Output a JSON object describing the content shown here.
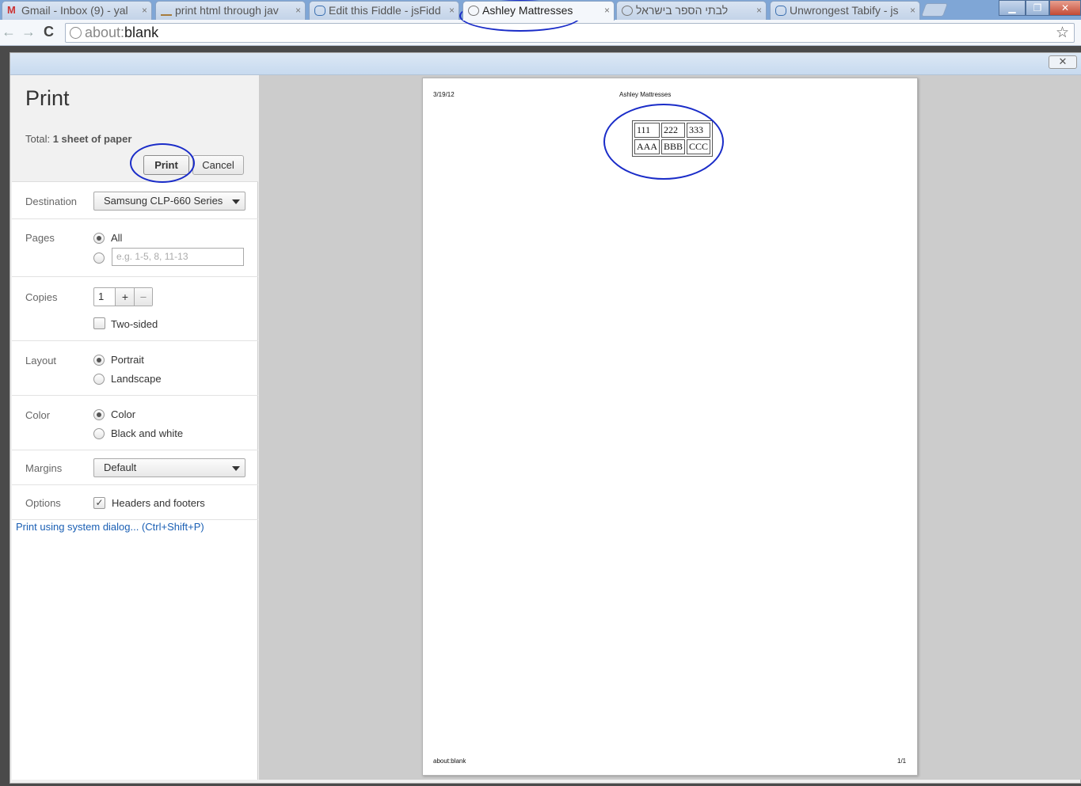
{
  "browser": {
    "tabs": [
      {
        "title": "Gmail - Inbox (9) - yal",
        "close": "×"
      },
      {
        "title": "print html through jav",
        "close": "×"
      },
      {
        "title": "Edit this Fiddle - jsFidd",
        "close": "×"
      },
      {
        "title": "Ashley Mattresses",
        "close": "×"
      },
      {
        "title": "לבתי הספר בישראל",
        "close": "×"
      },
      {
        "title": "Unwrongest Tabify - js",
        "close": "×"
      }
    ],
    "url_prefix": "about:",
    "url_rest": "blank",
    "star": "☆",
    "back": "←",
    "forward": "→",
    "reload": "C"
  },
  "dialog": {
    "close": "✕"
  },
  "print_panel": {
    "title": "Print",
    "total_label": "Total:",
    "total_value": "1 sheet of paper",
    "print_button": "Print",
    "cancel_button": "Cancel",
    "destination": {
      "label": "Destination",
      "value": "Samsung CLP-660 Series"
    },
    "pages": {
      "label": "Pages",
      "all": "All",
      "range_placeholder": "e.g. 1-5, 8, 11-13"
    },
    "copies": {
      "label": "Copies",
      "value": "1",
      "plus": "+",
      "minus": "–",
      "two_sided": "Two-sided"
    },
    "layout": {
      "label": "Layout",
      "portrait": "Portrait",
      "landscape": "Landscape"
    },
    "color": {
      "label": "Color",
      "color": "Color",
      "bw": "Black and white"
    },
    "margins": {
      "label": "Margins",
      "value": "Default"
    },
    "options": {
      "label": "Options",
      "headers_footers": "Headers and footers"
    },
    "system_dialog_link": "Print using system dialog... (Ctrl+Shift+P)"
  },
  "preview": {
    "header_date": "3/19/12",
    "header_title": "Ashley Mattresses",
    "footer_url": "about:blank",
    "footer_page": "1/1",
    "table": [
      [
        "111",
        "222",
        "333"
      ],
      [
        "AAA",
        "BBB",
        "CCC"
      ]
    ]
  },
  "colors": {
    "scribble": "#1a2cc8",
    "link": "#1a5fb4"
  }
}
